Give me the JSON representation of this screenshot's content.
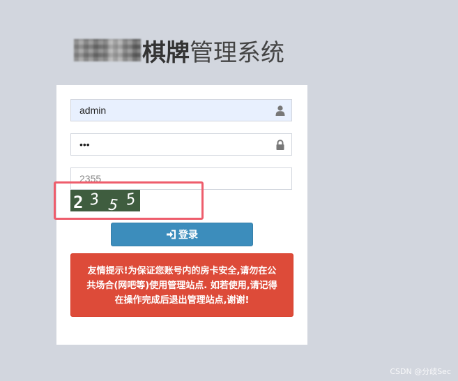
{
  "header": {
    "title_bold": "棋牌",
    "title_rest": "管理系统"
  },
  "login": {
    "username": {
      "value": "admin",
      "icon": "user-icon"
    },
    "password": {
      "value": "•••",
      "icon": "lock-icon"
    },
    "captcha_input": {
      "value": "2355"
    },
    "captcha_image": {
      "characters": [
        "2",
        "3",
        "5",
        "5"
      ],
      "background": "#3f5d3f",
      "color": "#ffffff"
    },
    "submit_label": "登录",
    "submit_icon": "sign-in-icon"
  },
  "notice": {
    "text": "友情提示!为保证您账号内的房卡安全,请勿在公共场合(网吧等)使用管理站点. 如若使用,请记得在操作完成后退出管理站点,谢谢!"
  },
  "watermark": {
    "text": "CSDN @分歧Sec"
  },
  "colors": {
    "page_background": "#d2d6de",
    "primary": "#3c8dbc",
    "danger": "#dd4b39",
    "highlight": "#ee5d6c"
  }
}
